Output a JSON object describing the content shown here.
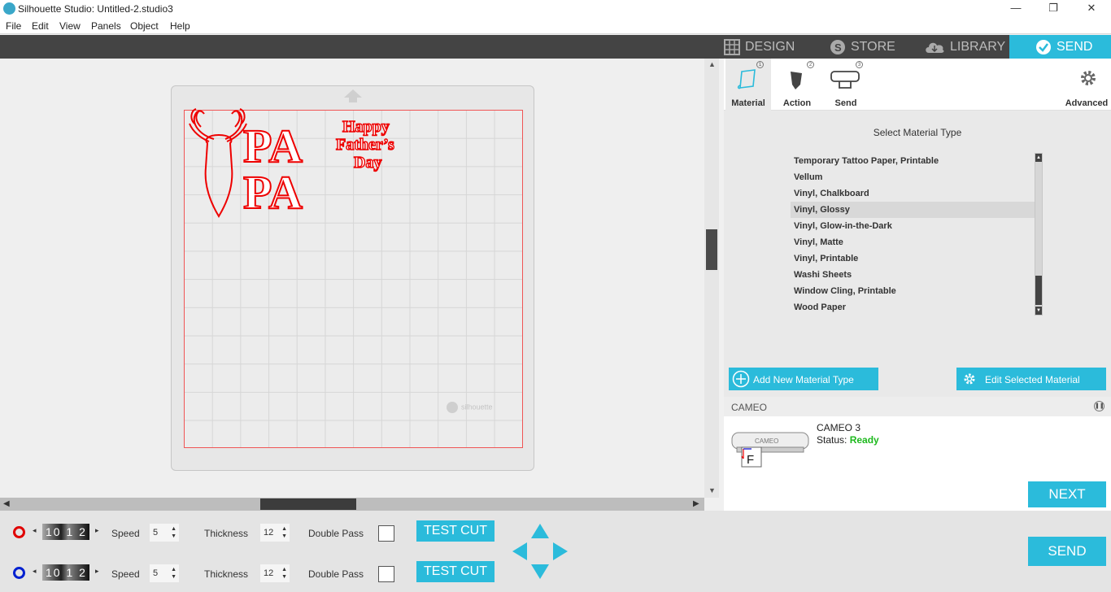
{
  "window": {
    "title": "Silhouette Studio: Untitled-2.studio3",
    "minimize": "—",
    "maximize": "❐",
    "close": "✕"
  },
  "menu": [
    "File",
    "Edit",
    "View",
    "Panels",
    "Object",
    "Help"
  ],
  "design_text": {
    "line1": "PA",
    "line2": "PA",
    "happy": "Happy",
    "fathers": "Father’s",
    "day": "Day"
  },
  "watermark": "silhouette",
  "tabs": [
    {
      "label": "DESIGN",
      "icon": "grid-icon"
    },
    {
      "label": "STORE",
      "icon": "silhouette-s-icon"
    },
    {
      "label": "LIBRARY",
      "icon": "cloud-download-icon"
    },
    {
      "label": "SEND",
      "icon": "check-circle-icon",
      "active": true
    }
  ],
  "steps": [
    {
      "label": "Material",
      "num": "1",
      "active": true
    },
    {
      "label": "Action",
      "num": "2"
    },
    {
      "label": "Send",
      "num": "3"
    }
  ],
  "advanced_label": "Advanced",
  "material": {
    "title": "Select Material Type",
    "items": [
      "Temporary Tattoo Paper, Printable",
      "Vellum",
      "Vinyl, Chalkboard",
      "Vinyl, Glossy",
      "Vinyl, Glow-in-the-Dark",
      "Vinyl, Matte",
      "Vinyl, Printable",
      "Washi Sheets",
      "Window Cling, Printable",
      "Wood Paper"
    ],
    "selected": "Vinyl, Glossy",
    "add_button": "Add New Material Type",
    "edit_button": "Edit Selected Material"
  },
  "device": {
    "section": "CAMEO",
    "name": "CAMEO 3",
    "status_label": "Status:",
    "status": "Ready",
    "image_label": "CAMEO",
    "image_letter": "F"
  },
  "next_button": "NEXT",
  "send_button": "SEND",
  "tool_rows": [
    {
      "color": "#e00000",
      "speed_label": "Speed",
      "speed": "5",
      "thickness_label": "Thickness",
      "thickness": "12",
      "double_pass_label": "Double Pass",
      "test_cut": "TEST CUT",
      "blade": "10 1 2"
    },
    {
      "color": "#0020d0",
      "speed_label": "Speed",
      "speed": "5",
      "thickness_label": "Thickness",
      "thickness": "12",
      "double_pass_label": "Double Pass",
      "test_cut": "TEST CUT",
      "blade": "10 1 2"
    }
  ],
  "colors": {
    "accent": "#2bbbdb",
    "cut_line": "#e00000",
    "ready": "#1db91d"
  }
}
